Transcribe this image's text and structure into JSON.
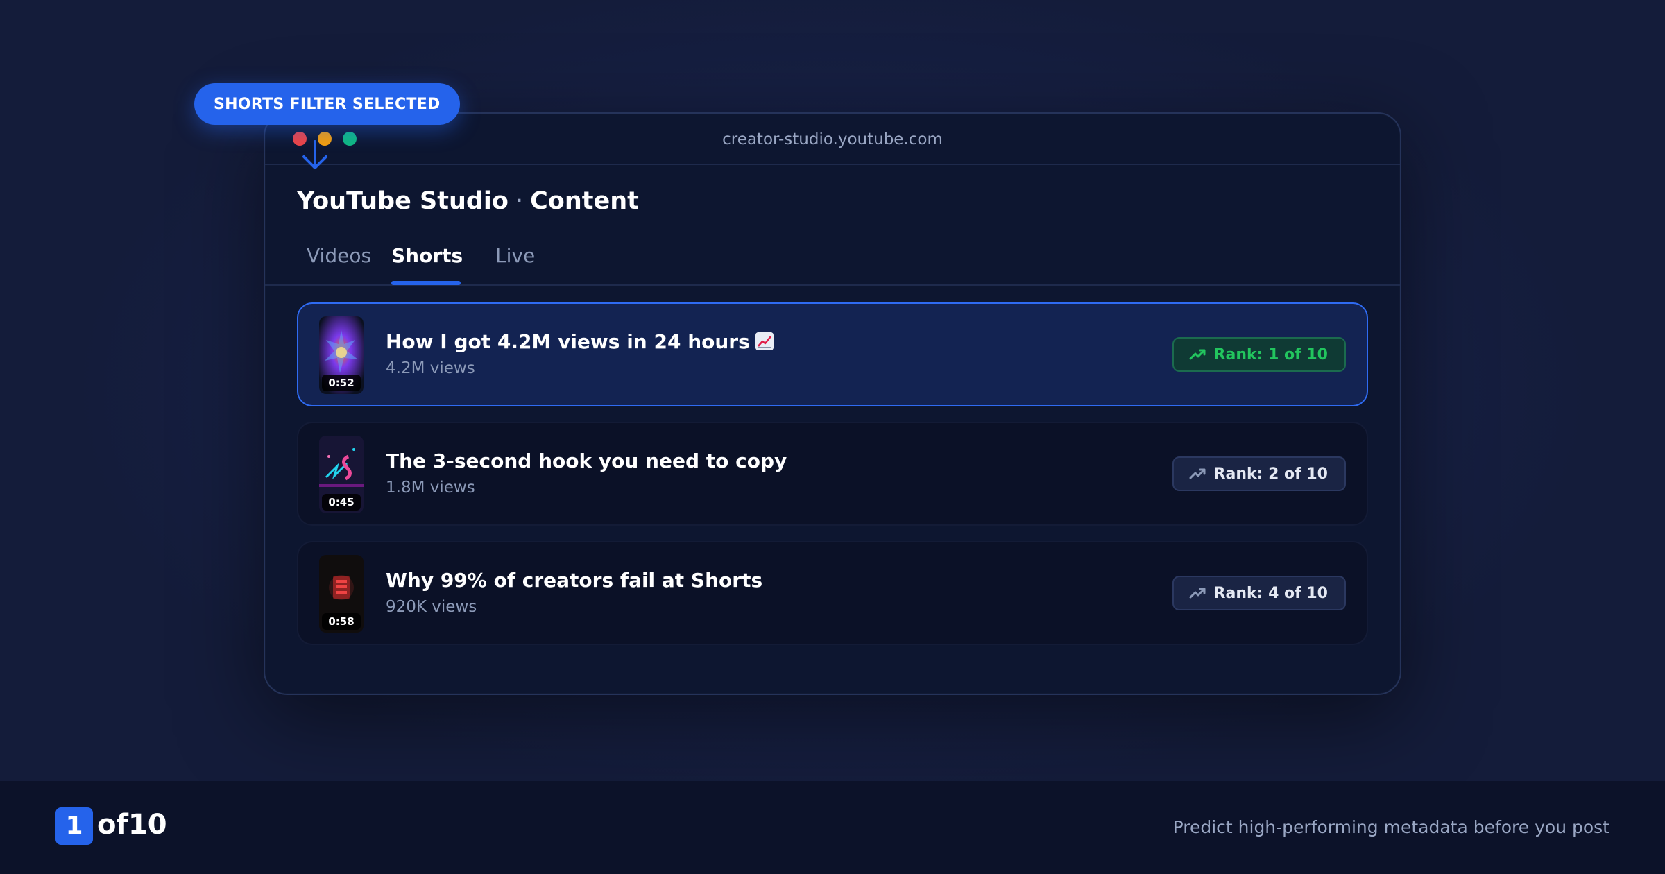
{
  "callout": {
    "label": "SHORTS FILTER SELECTED"
  },
  "window": {
    "url": "creator-studio.youtube.com",
    "app_title": "YouTube Studio",
    "app_title_separator": "·",
    "section_title": "Content"
  },
  "tabs": [
    {
      "label": "Videos",
      "active": false
    },
    {
      "label": "Shorts",
      "active": true
    },
    {
      "label": "Live",
      "active": false
    }
  ],
  "shorts": [
    {
      "title": "How I got 4.2M views in 24 hours",
      "emoji": "chart-increasing-emoji",
      "views": "4.2M views",
      "duration": "0:52",
      "rank": "Rank: 1 of 10",
      "selected": true
    },
    {
      "title": "The 3-second hook you need to copy",
      "views": "1.8M views",
      "duration": "0:45",
      "rank": "Rank: 2 of 10",
      "selected": false
    },
    {
      "title": "Why 99% of creators fail at Shorts",
      "views": "920K views",
      "duration": "0:58",
      "rank": "Rank: 4 of 10",
      "selected": false
    }
  ],
  "footer": {
    "page_current": "1",
    "page_of": "of10",
    "tagline": "Predict high-performing metadata before you post"
  },
  "colors": {
    "accent": "#2563eb",
    "rank_top": "#22c55e",
    "dot_red": "#ef4444",
    "dot_yellow": "#f59e0b",
    "dot_green": "#10b981"
  }
}
